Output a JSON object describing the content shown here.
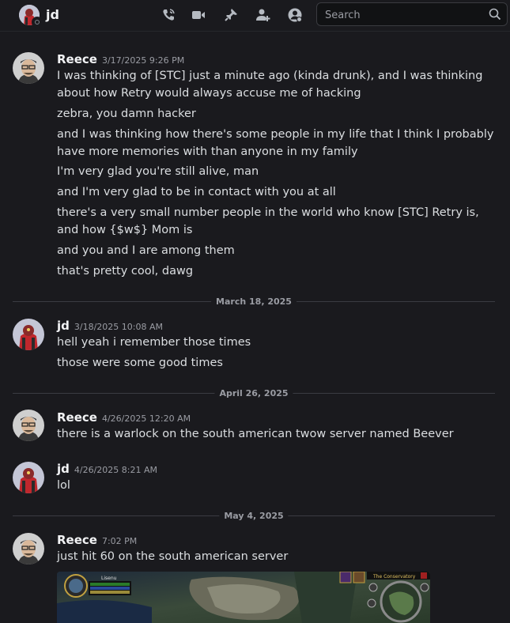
{
  "header": {
    "title": "jd",
    "search_placeholder": "Search",
    "icons": [
      "phone-icon",
      "video-icon",
      "pin-icon",
      "add-friend-icon",
      "user-profile-icon",
      "search-icon"
    ]
  },
  "messages": [
    {
      "author": "Reece",
      "timestamp": "3/17/2025 9:26 PM",
      "lines": [
        "I was thinking of [STC] just a minute ago (kinda drunk), and I was thinking about how Retry would always accuse me of hacking",
        "zebra, you damn hacker",
        "and I was thinking how there's some people in my life that I think I probably have more memories with than anyone in my family",
        "I'm very glad you're still alive, man",
        "and I'm very glad to be in contact with you at all",
        "there's a very small number people in the world who know [STC] Retry is, and how {$w$} Mom is",
        "and you and I are among them",
        "that's pretty cool, dawg"
      ]
    },
    {
      "author": "jd",
      "timestamp": "3/18/2025 10:08 AM",
      "lines": [
        "hell yeah i remember those times",
        "those were some good times"
      ]
    },
    {
      "author": "Reece",
      "timestamp": "4/26/2025 12:20 AM",
      "lines": [
        "there is a warlock on the south american twow server named Beever"
      ]
    },
    {
      "author": "jd",
      "timestamp": "4/26/2025 8:21 AM",
      "lines": [
        "lol"
      ]
    },
    {
      "author": "Reece",
      "timestamp": "7:02 PM",
      "lines": [
        "just hit 60 on the south american server"
      ]
    }
  ],
  "dividers": [
    "March 18, 2025",
    "April 26, 2025",
    "May 4, 2025"
  ],
  "attachment": {
    "hud_text": [
      "Lisenu",
      "The Conservatory"
    ]
  }
}
